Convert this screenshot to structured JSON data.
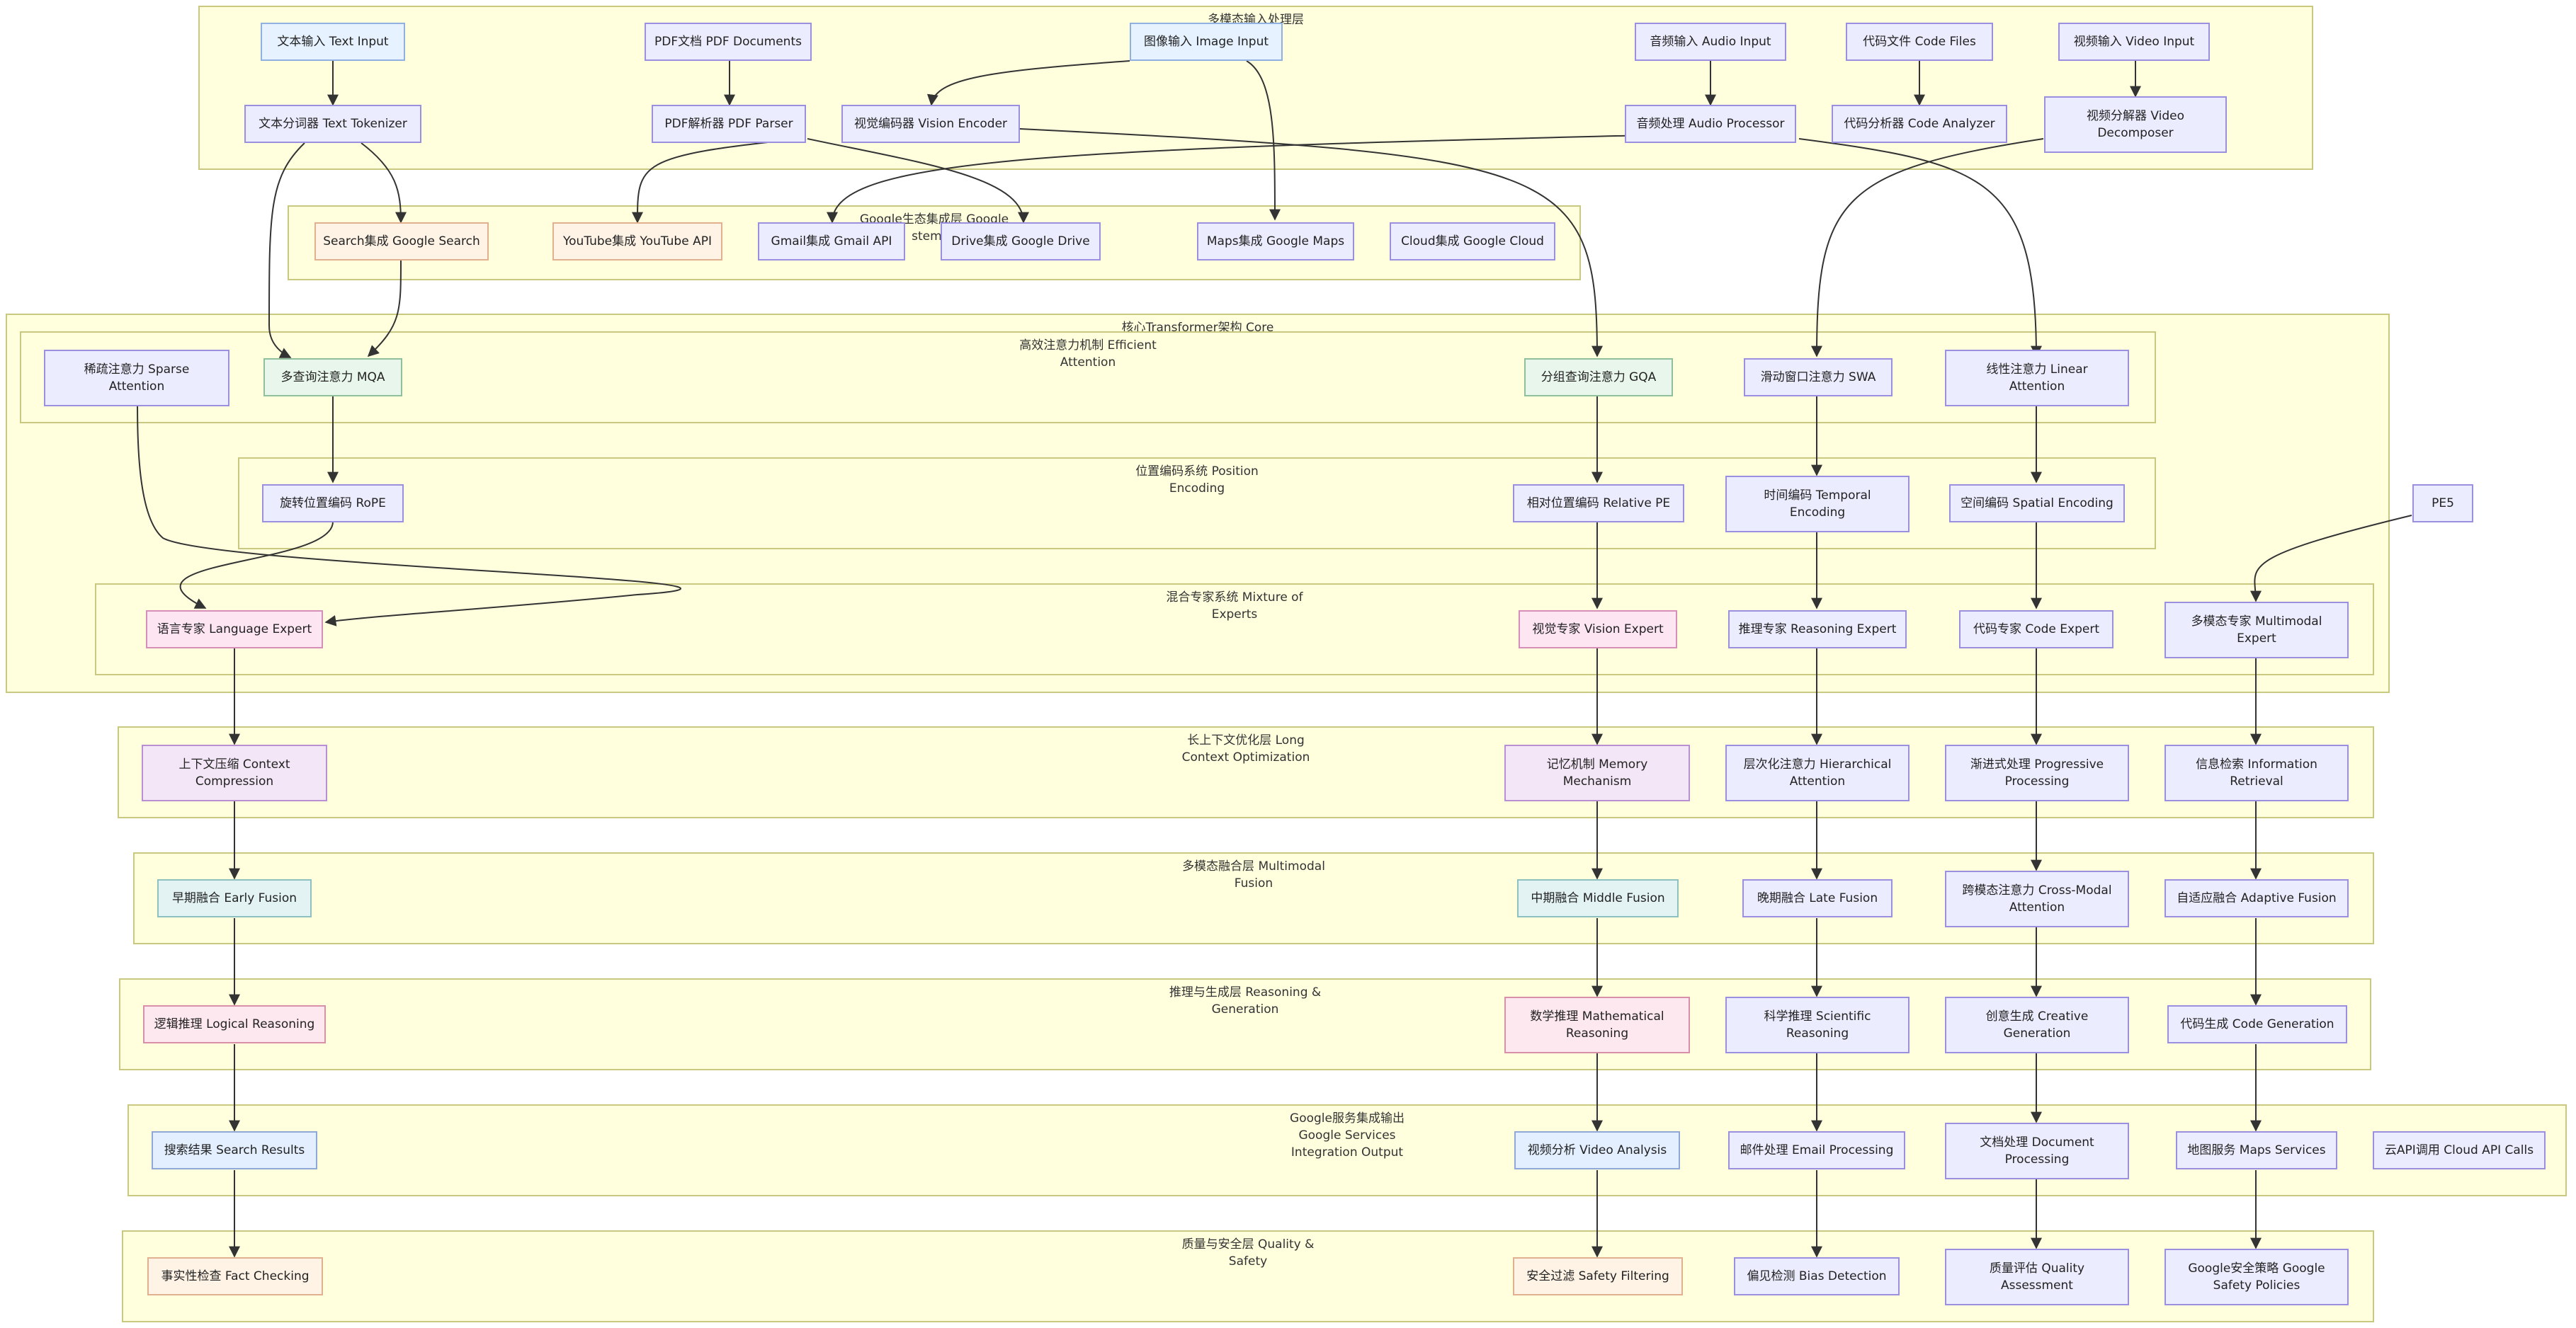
{
  "clusters": {
    "input": "多模态输入处理层\nLayer",
    "google": "Google生态集成层 Google\nstem In",
    "core": "核心Transformer架构 Core",
    "attention": "高效注意力机制 Efficient\nAttention",
    "position": "位置编码系统 Position\nEncoding",
    "moe": "混合专家系统 Mixture of\nExperts",
    "longctx": "长上下文优化层 Long\nContext Optimization",
    "fusion": "多模态融合层 Multimodal\nFusion",
    "reasoning": "推理与生成层 Reasoning &\nGeneration",
    "services": "Google服务集成输出\nGoogle Services\nIntegration Output",
    "quality": "质量与安全层 Quality &\nSafety"
  },
  "nodes": {
    "text_input": "文本输入 Text Input",
    "pdf_docs": "PDF文档 PDF Documents",
    "image_input": "图像输入 Image Input",
    "audio_input": "音频输入 Audio Input",
    "code_files": "代码文件 Code Files",
    "video_input": "视频输入 Video Input",
    "text_tokenizer": "文本分词器 Text Tokenizer",
    "pdf_parser": "PDF解析器 PDF Parser",
    "vision_encoder": "视觉编码器 Vision Encoder",
    "audio_processor": "音频处理 Audio Processor",
    "code_analyzer": "代码分析器 Code Analyzer",
    "video_decomposer": "视频分解器 Video\nDecomposer",
    "search": "Search集成 Google Search",
    "youtube": "YouTube集成 YouTube API",
    "gmail": "Gmail集成 Gmail API",
    "drive": "Drive集成 Google Drive",
    "maps": "Maps集成 Google Maps",
    "cloud": "Cloud集成 Google Cloud",
    "sparse": "稀疏注意力 Sparse\nAttention",
    "mqa": "多查询注意力 MQA",
    "gqa": "分组查询注意力 GQA",
    "swa": "滑动窗口注意力 SWA",
    "linear": "线性注意力 Linear\nAttention",
    "rope": "旋转位置编码 RoPE",
    "relpe": "相对位置编码 Relative PE",
    "temporal": "时间编码 Temporal\nEncoding",
    "spatial": "空间编码 Spatial Encoding",
    "pe5": "PE5",
    "lang_expert": "语言专家 Language Expert",
    "vision_expert": "视觉专家 Vision Expert",
    "reason_expert": "推理专家 Reasoning Expert",
    "code_expert": "代码专家 Code Expert",
    "mm_expert": "多模态专家 Multimodal\nExpert",
    "ctx_compress": "上下文压缩 Context\nCompression",
    "memory": "记忆机制 Memory\nMechanism",
    "hier_attn": "层次化注意力 Hierarchical\nAttention",
    "progressive": "渐进式处理 Progressive\nProcessing",
    "info_retrieval": "信息检索 Information\nRetrieval",
    "early_fusion": "早期融合 Early Fusion",
    "middle_fusion": "中期融合 Middle Fusion",
    "late_fusion": "晚期融合 Late Fusion",
    "cross_modal": "跨模态注意力 Cross-Modal\nAttention",
    "adaptive_fusion": "自适应融合 Adaptive Fusion",
    "logical": "逻辑推理 Logical Reasoning",
    "math": "数学推理 Mathematical\nReasoning",
    "scientific": "科学推理 Scientific\nReasoning",
    "creative": "创意生成 Creative\nGeneration",
    "codegen": "代码生成 Code Generation",
    "search_results": "搜索结果 Search Results",
    "video_analysis": "视频分析 Video Analysis",
    "email_proc": "邮件处理 Email Processing",
    "doc_proc": "文档处理 Document\nProcessing",
    "maps_services": "地图服务 Maps Services",
    "cloud_api": "云API调用 Cloud API Calls",
    "fact_check": "事实性检查 Fact Checking",
    "safety_filter": "安全过滤 Safety Filtering",
    "bias": "偏见检测 Bias Detection",
    "quality_assess": "质量评估 Quality\nAssessment",
    "safety_policies": "Google安全策略 Google\nSafety Policies"
  }
}
